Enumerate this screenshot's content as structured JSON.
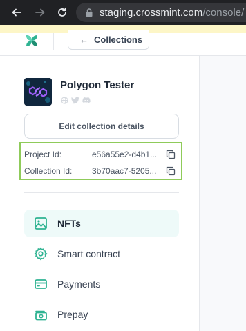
{
  "browser": {
    "url_host": "staging.crossmint.com",
    "url_path": "/console/"
  },
  "header": {
    "collections_label": "Collections"
  },
  "collection": {
    "name": "Polygon Tester",
    "edit_label": "Edit collection details",
    "project_id_label": "Project Id:",
    "project_id_value": "e56a55e2-d4b1...",
    "collection_id_label": "Collection Id:",
    "collection_id_value": "3b70aac7-5205..."
  },
  "nav": {
    "items": [
      {
        "label": "NFTs",
        "icon": "image-icon",
        "active": true
      },
      {
        "label": "Smart contract",
        "icon": "gear-icon",
        "active": false
      },
      {
        "label": "Payments",
        "icon": "credit-card-icon",
        "active": false
      },
      {
        "label": "Prepay",
        "icon": "cash-icon",
        "active": false
      }
    ]
  },
  "colors": {
    "accent": "#2fb392",
    "highlight_border": "#8fcb5a",
    "active_bg": "#eefaf9"
  }
}
